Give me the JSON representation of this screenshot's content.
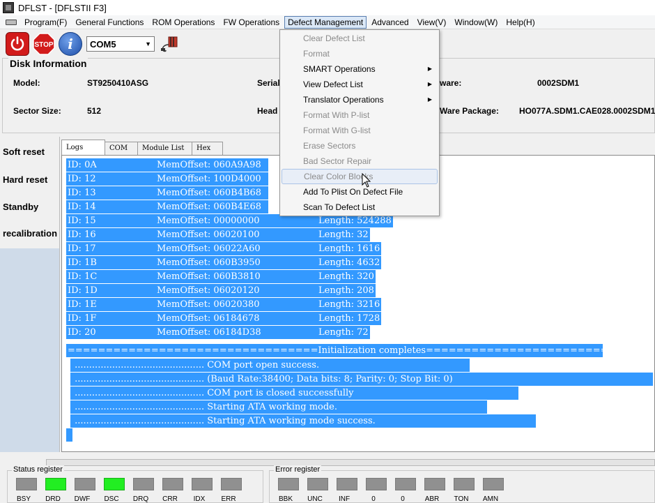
{
  "window": {
    "title": "DFLST - [DFLSTII  F3]"
  },
  "menubar": {
    "items": [
      "Program(F)",
      "General Functions",
      "ROM Operations",
      "FW Operations",
      "Defect Management",
      "Advanced",
      "View(V)",
      "Window(W)",
      "Help(H)"
    ],
    "active": "Defect Management"
  },
  "toolbar": {
    "port": "COM5",
    "stop_label": "STOP",
    "info_label": "i"
  },
  "disk_info": {
    "legend": "Disk Information",
    "model_label": "Model:",
    "model_value": "ST9250410ASG",
    "serial_label": "Serial",
    "firmware_label": "ware:",
    "firmware_value": "0002SDM1",
    "sector_label": "Sector Size:",
    "sector_value": "512",
    "head_label": "Head",
    "package_label": "Ware Package:",
    "package_value": "HO077A.SDM1.CAE028.0002SDM1"
  },
  "left_commands": [
    "Soft reset",
    "Hard reset",
    "Standby",
    "recalibration"
  ],
  "tabs": [
    "Logs",
    "COM",
    "Module List",
    "Hex"
  ],
  "active_tab": "Logs",
  "log": {
    "entries": [
      {
        "id": "ID: 0A",
        "offset": "MemOffset: 060A9A98",
        "length": ""
      },
      {
        "id": "ID: 12",
        "offset": "MemOffset: 100D4000",
        "length": ""
      },
      {
        "id": "ID: 13",
        "offset": "MemOffset: 060B4B68",
        "length": ""
      },
      {
        "id": "ID: 14",
        "offset": "MemOffset: 060B4E68",
        "length": ""
      },
      {
        "id": "ID: 15",
        "offset": "MemOffset: 00000000",
        "length": "Length: 524288"
      },
      {
        "id": "ID: 16",
        "offset": "MemOffset: 06020100",
        "length": "Length: 32"
      },
      {
        "id": "ID: 17",
        "offset": "MemOffset: 06022A60",
        "length": "Length: 1616"
      },
      {
        "id": "ID: 1B",
        "offset": "MemOffset: 060B3950",
        "length": "Length: 4632"
      },
      {
        "id": "ID: 1C",
        "offset": "MemOffset: 060B3810",
        "length": "Length: 320"
      },
      {
        "id": "ID: 1D",
        "offset": "MemOffset: 06020120",
        "length": "Length: 208"
      },
      {
        "id": "ID: 1E",
        "offset": "MemOffset: 06020380",
        "length": "Length: 3216"
      },
      {
        "id": "ID: 1F",
        "offset": "MemOffset: 06184678",
        "length": "Length: 1728"
      },
      {
        "id": "ID: 20",
        "offset": "MemOffset: 06184D38",
        "length": "Length: 72"
      }
    ],
    "init_line": "=================================Initialization completes=================================.",
    "messages": [
      " ............................................. COM port open success.",
      " ............................................. (Baud Rate:38400; Data bits: 8; Parity: 0; Stop Bit: 0)",
      " ............................................. COM port is closed successfully",
      " ............................................. Starting ATA working mode.",
      " ............................................. Starting ATA working mode success."
    ]
  },
  "status_register": {
    "title": "Status register",
    "leds": [
      {
        "label": "BSY",
        "on": false
      },
      {
        "label": "DRD",
        "on": true
      },
      {
        "label": "DWF",
        "on": false
      },
      {
        "label": "DSC",
        "on": true
      },
      {
        "label": "DRQ",
        "on": false
      },
      {
        "label": "CRR",
        "on": false
      },
      {
        "label": "IDX",
        "on": false
      },
      {
        "label": "ERR",
        "on": false
      }
    ]
  },
  "error_register": {
    "title": "Error register",
    "leds": [
      {
        "label": "BBK",
        "on": false
      },
      {
        "label": "UNC",
        "on": false
      },
      {
        "label": "INF",
        "on": false
      },
      {
        "label": "0",
        "on": false
      },
      {
        "label": "0",
        "on": false
      },
      {
        "label": "ABR",
        "on": false
      },
      {
        "label": "TON",
        "on": false
      },
      {
        "label": "AMN",
        "on": false
      }
    ]
  },
  "defect_menu": {
    "items": [
      {
        "label": "Clear Defect List",
        "disabled": true,
        "submenu": false
      },
      {
        "label": "Format",
        "disabled": true,
        "submenu": false
      },
      {
        "label": "SMART Operations",
        "disabled": false,
        "submenu": true
      },
      {
        "label": "View Defect List",
        "disabled": false,
        "submenu": true
      },
      {
        "label": "Translator Operations",
        "disabled": false,
        "submenu": true
      },
      {
        "label": "Format With P-list",
        "disabled": true,
        "submenu": false
      },
      {
        "label": "Format With G-list",
        "disabled": true,
        "submenu": false
      },
      {
        "label": "Erase Sectors",
        "disabled": true,
        "submenu": false
      },
      {
        "label": "Bad Sector Repair",
        "disabled": true,
        "submenu": false
      },
      {
        "label": "Clear Color Blocks",
        "disabled": true,
        "submenu": false,
        "hover": true
      },
      {
        "label": "Add To Plist On Defect File",
        "disabled": false,
        "submenu": false
      },
      {
        "label": "Scan To Defect List",
        "disabled": false,
        "submenu": false
      }
    ]
  },
  "colors": {
    "selection": "#3399ff",
    "led_on": "#22ee22",
    "led_off": "#909090",
    "stop_red": "#d21b1b"
  }
}
